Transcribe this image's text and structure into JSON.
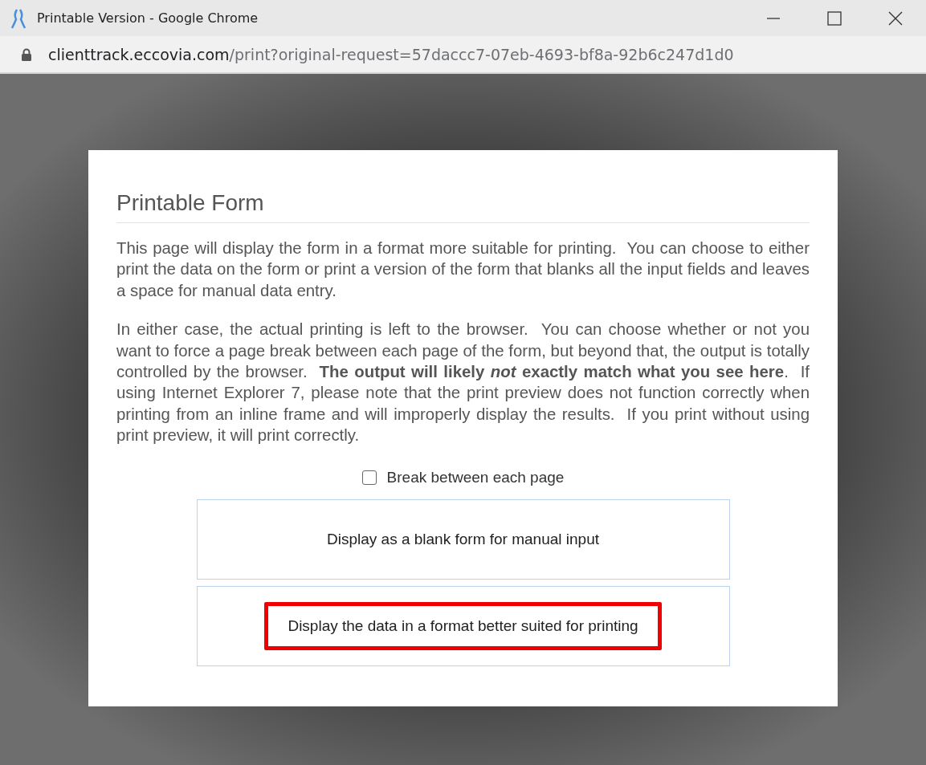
{
  "window": {
    "title": "Printable Version - Google Chrome"
  },
  "address_bar": {
    "host": "clienttrack.eccovia.com",
    "path": "/print?original-request=57daccc7-07eb-4693-bf8a-92b6c247d1d0"
  },
  "dialog": {
    "title": "Printable Form",
    "paragraphs": [
      "This page will display the form in a format more suitable for printing.  You can choose to either print the data on the form or print a version of the form that blanks all the input fields and leaves a space for manual data entry.",
      "In either case, the actual printing is left to the browser.  You can choose whether or not you want to force a page break between each page of the form, but beyond that, the output is totally controlled by the browser.  **The output will likely *not* exactly match what you see here**.  If using Internet Explorer 7, please note that the print preview does not function correctly when printing from an inline frame and will improperly display the results.  If you print without using print preview, it will print correctly."
    ],
    "checkbox": {
      "label": "Break between each page",
      "checked": false
    },
    "options": [
      {
        "label": "Display as a blank form for manual input",
        "highlighted": false
      },
      {
        "label": "Display the data in a format better suited for printing",
        "highlighted": true
      }
    ]
  }
}
